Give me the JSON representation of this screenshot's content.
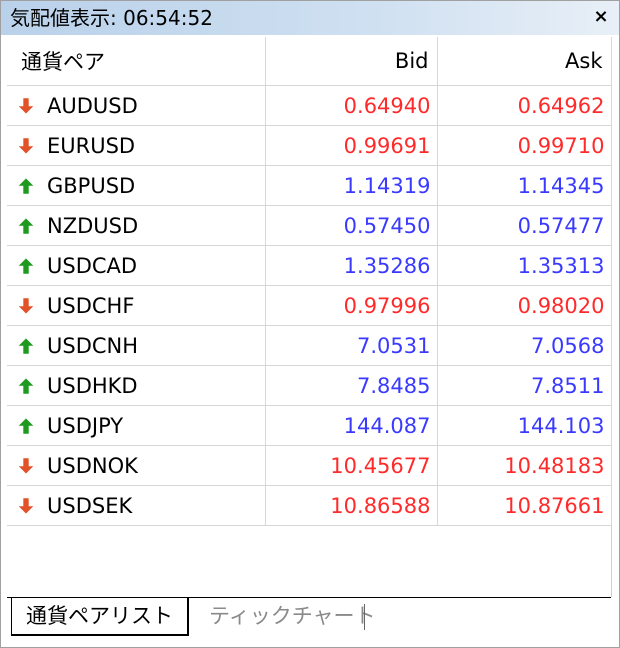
{
  "window": {
    "title": "気配値表示: 06:54:52",
    "close_label": "×"
  },
  "columns": {
    "symbol": "通貨ペア",
    "bid": "Bid",
    "ask": "Ask"
  },
  "rows": [
    {
      "symbol": "AUDUSD",
      "bid": "0.64940",
      "ask": "0.64962",
      "direction": "down"
    },
    {
      "symbol": "EURUSD",
      "bid": "0.99691",
      "ask": "0.99710",
      "direction": "down"
    },
    {
      "symbol": "GBPUSD",
      "bid": "1.14319",
      "ask": "1.14345",
      "direction": "up"
    },
    {
      "symbol": "NZDUSD",
      "bid": "0.57450",
      "ask": "0.57477",
      "direction": "up"
    },
    {
      "symbol": "USDCAD",
      "bid": "1.35286",
      "ask": "1.35313",
      "direction": "up"
    },
    {
      "symbol": "USDCHF",
      "bid": "0.97996",
      "ask": "0.98020",
      "direction": "down"
    },
    {
      "symbol": "USDCNH",
      "bid": "7.0531",
      "ask": "7.0568",
      "direction": "up"
    },
    {
      "symbol": "USDHKD",
      "bid": "7.8485",
      "ask": "7.8511",
      "direction": "up"
    },
    {
      "symbol": "USDJPY",
      "bid": "144.087",
      "ask": "144.103",
      "direction": "up"
    },
    {
      "symbol": "USDNOK",
      "bid": "10.45677",
      "ask": "10.48183",
      "direction": "down"
    },
    {
      "symbol": "USDSEK",
      "bid": "10.86588",
      "ask": "10.87661",
      "direction": "down"
    }
  ],
  "colors": {
    "down": "#ff2a2a",
    "up": "#3a3aff",
    "arrow_down": "#e0522a",
    "arrow_up": "#1e9a1e"
  },
  "tabs": [
    {
      "label": "通貨ペアリスト",
      "active": true
    },
    {
      "label": "ティックチャート",
      "active": false
    }
  ]
}
